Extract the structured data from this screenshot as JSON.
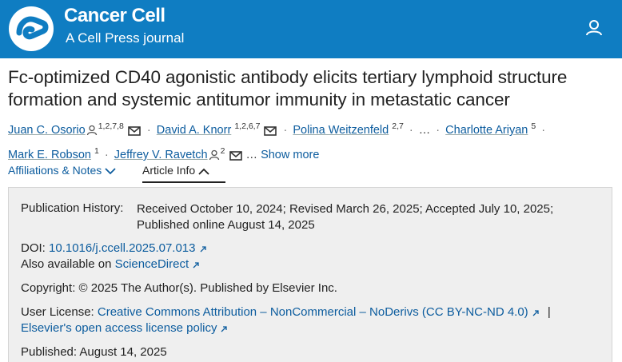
{
  "header": {
    "journal_name": "Cancer Cell",
    "journal_subtitle": "A Cell Press journal",
    "brand_color": "#0f7dc2"
  },
  "article": {
    "title": "Fc-optimized CD40 agonistic antibody elicits tertiary lymphoid structure formation and systemic antitumor immunity in metastatic cancer"
  },
  "authors": {
    "list": [
      {
        "name": "Juan C. Osorio",
        "sup": "1,2,7,8"
      },
      {
        "name": "David A. Knorr",
        "sup": "1,2,6,7"
      },
      {
        "name": "Polina Weitzenfeld",
        "sup": "2,7"
      },
      {
        "name": "Charlotte Ariyan",
        "sup": "5"
      },
      {
        "name": "Mark E. Robson",
        "sup": "1"
      },
      {
        "name": "Jeffrey V. Ravetch",
        "sup": "2"
      }
    ],
    "ellipsis": "…",
    "show_more": "Show more"
  },
  "tabs": {
    "affiliations": "Affiliations & Notes",
    "article_info": "Article Info"
  },
  "article_info": {
    "history_label": "Publication History:",
    "history_text": "Received October 10, 2024; Revised March 26, 2025; Accepted July 10, 2025; Published online August 14, 2025",
    "doi_label": "DOI:",
    "doi_value": "10.1016/j.ccell.2025.07.013",
    "also_available": "Also available on",
    "sciencedirect": "ScienceDirect",
    "copyright": "Copyright: © 2025 The Author(s). Published by Elsevier Inc.",
    "license_label": "User License:",
    "license_value": "Creative Commons Attribution – NonCommercial – NoDerivs (CC BY-NC-ND 4.0)",
    "license_sep": "|",
    "oa_policy": "Elsevier's open access license policy",
    "published_label": "Published:",
    "published_value": "August 14, 2025"
  }
}
